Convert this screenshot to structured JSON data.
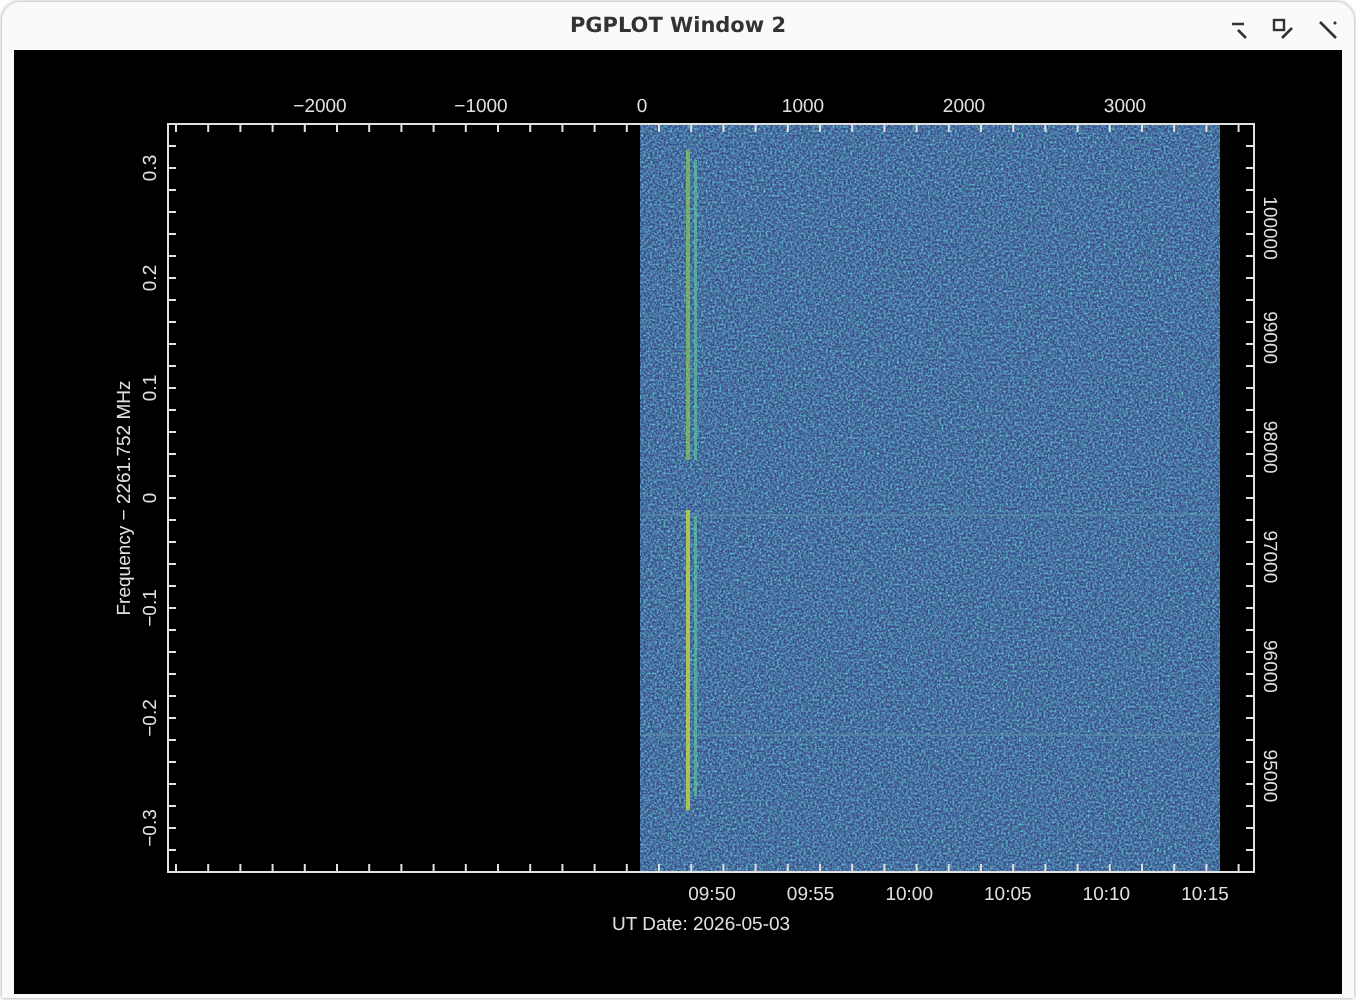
{
  "window": {
    "title": "PGPLOT Window 2"
  },
  "plot": {
    "top_axis": {
      "ticks": [
        "−2000",
        "−1000",
        "0",
        "1000",
        "2000",
        "3000"
      ]
    },
    "left_axis": {
      "label": "Frequency − 2261.752 MHz",
      "ticks": [
        "0.3",
        "0.2",
        "0.1",
        "0",
        "−0.1",
        "−0.2",
        "−0.3"
      ]
    },
    "right_axis": {
      "ticks": [
        "100000",
        "99000",
        "98000",
        "97000",
        "96000",
        "95000"
      ]
    },
    "bottom_axis": {
      "ticks": [
        "09:50",
        "09:55",
        "10:00",
        "10:05",
        "10:10",
        "10:15"
      ]
    },
    "footer": "UT Date: 2026-05-03"
  }
}
